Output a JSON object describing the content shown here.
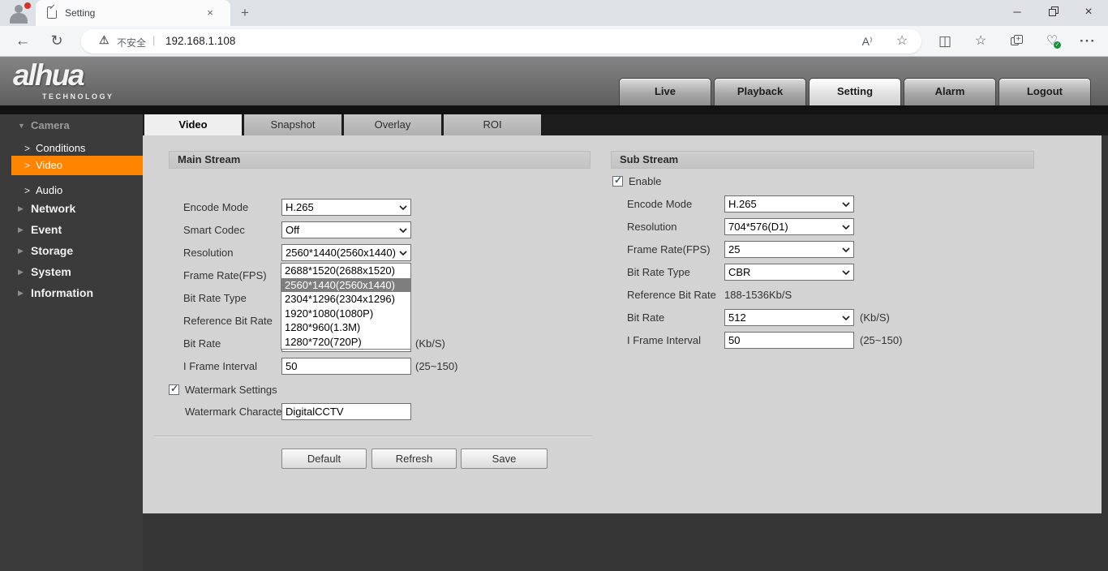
{
  "icons": {
    "close": "×",
    "new_tab": "+",
    "minimize": "─",
    "more": "···",
    "back": "←",
    "refresh": "↻",
    "warning": "⚠",
    "star": "☆",
    "read_aloud": "A⁾",
    "split": "◫",
    "heart": "♡",
    "heart_check": "✓",
    "plus": "+",
    "check": "✓",
    "tri_down": "▼",
    "tri_right": "▶",
    "sub_arrow": ">",
    "separator": "|"
  },
  "titlebar": {
    "tab_title": "Setting"
  },
  "toolbar": {
    "security_label": "不安全",
    "url": "192.168.1.108"
  },
  "header": {
    "logo_text": "alhua",
    "logo_subtext": "TECHNOLOGY",
    "nav_buttons": [
      {
        "label": "Live",
        "active": false
      },
      {
        "label": "Playback",
        "active": false
      },
      {
        "label": "Setting",
        "active": true
      },
      {
        "label": "Alarm",
        "active": false
      },
      {
        "label": "Logout",
        "active": false
      }
    ]
  },
  "sidebar": {
    "active_color": "#ff8400",
    "groups": [
      {
        "label": "Camera",
        "expanded": true
      },
      {
        "label": "Network"
      },
      {
        "label": "Event"
      },
      {
        "label": "Storage"
      },
      {
        "label": "System"
      },
      {
        "label": "Information"
      }
    ],
    "camera_children": [
      {
        "label": "Conditions",
        "active": false
      },
      {
        "label": "Video",
        "active": true
      },
      {
        "label": "Audio",
        "active": false
      }
    ]
  },
  "tabs": {
    "items": [
      {
        "label": "Video",
        "active": true
      },
      {
        "label": "Snapshot",
        "active": false
      },
      {
        "label": "Overlay",
        "active": false
      },
      {
        "label": "ROI",
        "active": false
      }
    ]
  },
  "main_stream": {
    "title": "Main Stream",
    "rows": {
      "encode_mode": {
        "label": "Encode Mode",
        "value": "H.265"
      },
      "smart_codec": {
        "label": "Smart Codec",
        "value": "Off"
      },
      "resolution": {
        "label": "Resolution",
        "value": "2560*1440(2560x1440)"
      },
      "frame_rate": {
        "label": "Frame Rate(FPS)",
        "value": ""
      },
      "bit_rate_type": {
        "label": "Bit Rate Type",
        "value": ""
      },
      "reference_bit_rate": {
        "label": "Reference Bit Rate",
        "value": ""
      },
      "bit_rate": {
        "label": "Bit Rate",
        "value": "",
        "hint": "(Kb/S)"
      },
      "i_frame_interval": {
        "label": "I Frame Interval",
        "value": "50",
        "hint": "(25~150)"
      },
      "watermark_settings": {
        "label": "Watermark Settings",
        "checked": true
      },
      "watermark_character": {
        "label": "Watermark Character",
        "value": "DigitalCCTV"
      }
    },
    "resolution_dropdown": {
      "selected_index": 1,
      "options": [
        "2688*1520(2688x1520)",
        "2560*1440(2560x1440)",
        "2304*1296(2304x1296)",
        "1920*1080(1080P)",
        "1280*960(1.3M)",
        "1280*720(720P)"
      ]
    }
  },
  "sub_stream": {
    "title": "Sub Stream",
    "enable": {
      "label": "Enable",
      "checked": true
    },
    "rows": {
      "encode_mode": {
        "label": "Encode Mode",
        "value": "H.265"
      },
      "resolution": {
        "label": "Resolution",
        "value": "704*576(D1)"
      },
      "frame_rate": {
        "label": "Frame Rate(FPS)",
        "value": "25"
      },
      "bit_rate_type": {
        "label": "Bit Rate Type",
        "value": "CBR"
      },
      "reference_bit_rate": {
        "label": "Reference Bit Rate",
        "value": "188-1536Kb/S"
      },
      "bit_rate": {
        "label": "Bit Rate",
        "value": "512",
        "hint": "(Kb/S)"
      },
      "i_frame_interval": {
        "label": "I Frame Interval",
        "value": "50",
        "hint": "(25~150)"
      }
    }
  },
  "actions": {
    "default_label": "Default",
    "refresh_label": "Refresh",
    "save_label": "Save"
  }
}
